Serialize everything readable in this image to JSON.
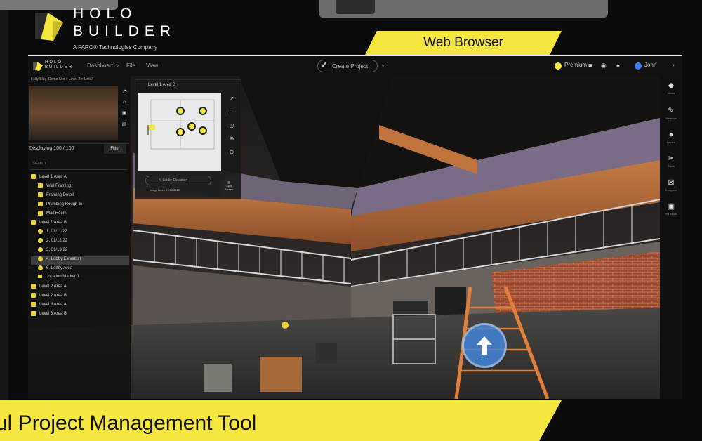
{
  "brand": {
    "word_line1": "HOLO",
    "word_line2": "BUILDER",
    "tagline": "A FARO® Technologies Company",
    "colors": {
      "yellow": "#f6e640",
      "dark": "#0b0b0b"
    }
  },
  "banners": {
    "web_browser": "Web Browser",
    "bottom": "ul Project Management Tool"
  },
  "toolbar": {
    "logo_text_1": "HOLO",
    "logo_text_2": "BUILDER",
    "menu": [
      "Dashboard >",
      "File",
      "View"
    ],
    "center_button": "Create Project",
    "right": {
      "plan": "Premium",
      "user": "John"
    }
  },
  "panel": {
    "path": "Kelly Bldg. Demo Site > Level 2 > Unit 3",
    "count": "Displaying 100 / 100",
    "filter_label": "Filter",
    "search_placeholder": "Search",
    "tree": [
      {
        "label": "Level 1 Area A",
        "level": 0,
        "icon": "level"
      },
      {
        "label": "Wall Framing",
        "level": 1,
        "icon": "sheet"
      },
      {
        "label": "Framing Detail",
        "level": 1,
        "icon": "sheet"
      },
      {
        "label": "Plumbing Rough-In",
        "level": 1,
        "icon": "sheet"
      },
      {
        "label": "Mail Room",
        "level": 1,
        "icon": "sheet"
      },
      {
        "label": "Level 1 Area B",
        "level": 0,
        "icon": "level"
      },
      {
        "label": "1. 01/11/22",
        "level": 1,
        "icon": "dot"
      },
      {
        "label": "2. 01/12/22",
        "level": 1,
        "icon": "dot"
      },
      {
        "label": "3. 01/13/22",
        "level": 1,
        "icon": "dot"
      },
      {
        "label": "4. Lobby Elevation",
        "level": 1,
        "icon": "dot",
        "selected": true
      },
      {
        "label": "5. Lobby Area",
        "level": 1,
        "icon": "dot"
      },
      {
        "label": "Location Marker 1",
        "level": 1,
        "icon": "flag"
      },
      {
        "label": "Level 2 Area A",
        "level": 0,
        "icon": "level"
      },
      {
        "label": "Level 2 Area B",
        "level": 0,
        "icon": "level"
      },
      {
        "label": "Level 3 Area A",
        "level": 0,
        "icon": "level"
      },
      {
        "label": "Level 3 Area B",
        "level": 0,
        "icon": "level"
      }
    ]
  },
  "minimap": {
    "title": "Level 1 Area B",
    "selector": "4. Lobby Elevation",
    "note": "Image taken 01/13/2022",
    "split_label": "Split Screen"
  },
  "rail": [
    {
      "icon": "layers-icon",
      "glyph": "◆",
      "label": "Views"
    },
    {
      "icon": "measure-icon",
      "glyph": "✎",
      "label": "Measure"
    },
    {
      "icon": "issues-icon",
      "glyph": "●",
      "label": "Issues"
    },
    {
      "icon": "attach-icon",
      "glyph": "✂",
      "label": "Tools"
    },
    {
      "icon": "compare-icon",
      "glyph": "⊠",
      "label": "Compare"
    },
    {
      "icon": "vr-icon",
      "glyph": "▣",
      "label": "VR Mode"
    }
  ]
}
